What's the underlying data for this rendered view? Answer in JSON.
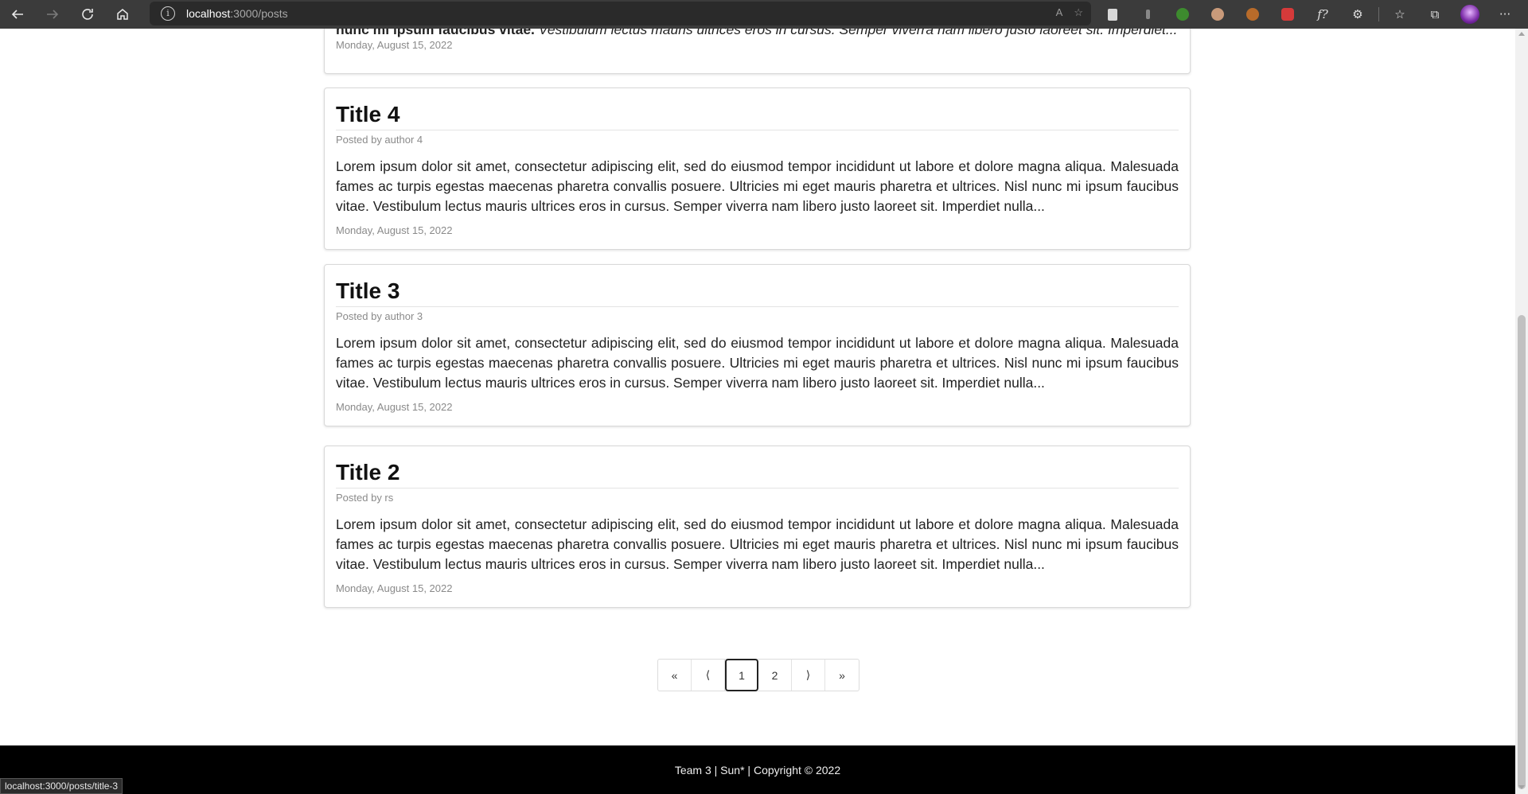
{
  "browser": {
    "url_host": "localhost",
    "url_path": ":3000/posts",
    "read_aloud_label": "A",
    "extension_icons": [
      "page-icon",
      "pin-icon",
      "tree-icon",
      "face-icon",
      "cookie-icon",
      "red-icon",
      "formula-icon",
      "puzzle-icon",
      "favorites-icon",
      "collections-icon"
    ],
    "formula_label": "f?",
    "more_label": "···"
  },
  "partial_post": {
    "bold_text": "nunc mi ipsum faucibus vitae.",
    "italic_text": "Vestibulum lectus mauris ultrices eros in cursus. Semper viverra nam libero justo laoreet sit. Imperdiet...",
    "date": "Monday, August 15, 2022"
  },
  "posts": [
    {
      "title": "Title 4",
      "author": "Posted by author 4",
      "excerpt": "Lorem ipsum dolor sit amet, consectetur adipiscing elit, sed do eiusmod tempor incididunt ut labore et dolore magna aliqua. Malesuada fames ac turpis egestas maecenas pharetra convallis posuere. Ultricies mi eget mauris pharetra et ultrices. Nisl nunc mi ipsum faucibus vitae. Vestibulum lectus mauris ultrices eros in cursus. Semper viverra nam libero justo laoreet sit. Imperdiet nulla...",
      "date": "Monday, August 15, 2022"
    },
    {
      "title": "Title 3",
      "author": "Posted by author 3",
      "excerpt": "Lorem ipsum dolor sit amet, consectetur adipiscing elit, sed do eiusmod tempor incididunt ut labore et dolore magna aliqua. Malesuada fames ac turpis egestas maecenas pharetra convallis posuere. Ultricies mi eget mauris pharetra et ultrices. Nisl nunc mi ipsum faucibus vitae. Vestibulum lectus mauris ultrices eros in cursus. Semper viverra nam libero justo laoreet sit. Imperdiet nulla...",
      "date": "Monday, August 15, 2022"
    },
    {
      "title": "Title 2",
      "author": "Posted by rs",
      "excerpt": "Lorem ipsum dolor sit amet, consectetur adipiscing elit, sed do eiusmod tempor incididunt ut labore et dolore magna aliqua. Malesuada fames ac turpis egestas maecenas pharetra convallis posuere. Ultricies mi eget mauris pharetra et ultrices. Nisl nunc mi ipsum faucibus vitae. Vestibulum lectus mauris ultrices eros in cursus. Semper viverra nam libero justo laoreet sit. Imperdiet nulla...",
      "date": "Monday, August 15, 2022"
    }
  ],
  "pagination": {
    "first": "«",
    "prev": "⟨",
    "pages": [
      "1",
      "2"
    ],
    "active_page": "1",
    "next": "⟩",
    "last": "»"
  },
  "footer": {
    "text": "Team 3 | Sun* | Copyright © 2022"
  },
  "status_bar": {
    "hover_url": "localhost:3000/posts/title-3"
  },
  "colors": {
    "chrome_bg": "#3b3b3b",
    "footer_bg": "#000000",
    "muted_text": "#8a8a8a"
  }
}
